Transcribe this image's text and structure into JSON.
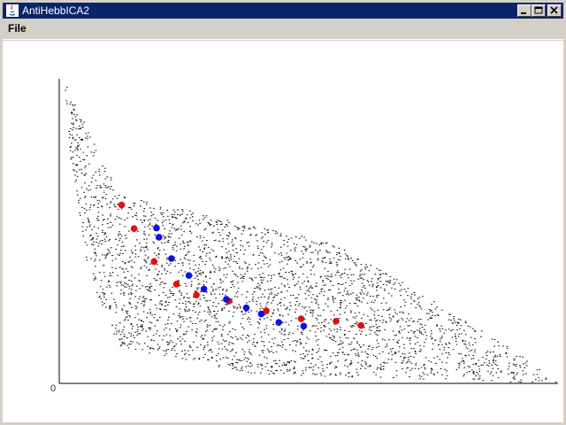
{
  "window": {
    "title": "AntiHebbICA2",
    "controls": [
      "minimize",
      "maximize",
      "close"
    ]
  },
  "menu": {
    "items": [
      "File"
    ]
  },
  "plot": {
    "origin_label": "0",
    "colors": {
      "cloud": "#000000",
      "red_points": "#e01010",
      "blue_points": "#1010e0",
      "axes": "#000000",
      "titlebar": "#0a246a"
    }
  },
  "chart_data": {
    "type": "scatter",
    "title": "",
    "xlabel": "",
    "ylabel": "",
    "xlim": [
      0,
      100
    ],
    "ylim": [
      0,
      100
    ],
    "cloud": {
      "color": "#000000",
      "description_points": 3000,
      "region": [
        [
          1,
          99
        ],
        [
          12,
          62
        ],
        [
          55,
          46
        ],
        [
          65,
          37
        ],
        [
          92,
          10
        ],
        [
          100,
          0
        ],
        [
          85,
          1
        ],
        [
          40,
          3
        ],
        [
          12,
          12
        ],
        [
          6,
          35
        ],
        [
          2,
          75
        ]
      ]
    },
    "series": [
      {
        "color": "#e01010",
        "points": [
          [
            12.5,
            58.6
          ],
          [
            15.0,
            50.8
          ],
          [
            19.0,
            40.0
          ],
          [
            23.5,
            32.6
          ],
          [
            27.5,
            29.0
          ],
          [
            34.0,
            27.0
          ],
          [
            41.5,
            23.8
          ],
          [
            48.5,
            21.2
          ],
          [
            55.5,
            20.4
          ],
          [
            60.5,
            19.0
          ]
        ]
      },
      {
        "color": "#1010e0",
        "points": [
          [
            19.5,
            51.0
          ],
          [
            20.0,
            48.0
          ],
          [
            22.5,
            41.0
          ],
          [
            26.0,
            35.4
          ],
          [
            29.0,
            31.0
          ],
          [
            33.5,
            27.6
          ],
          [
            37.5,
            24.8
          ],
          [
            40.5,
            22.8
          ],
          [
            44.0,
            20.0
          ],
          [
            49.0,
            18.8
          ]
        ]
      }
    ]
  }
}
